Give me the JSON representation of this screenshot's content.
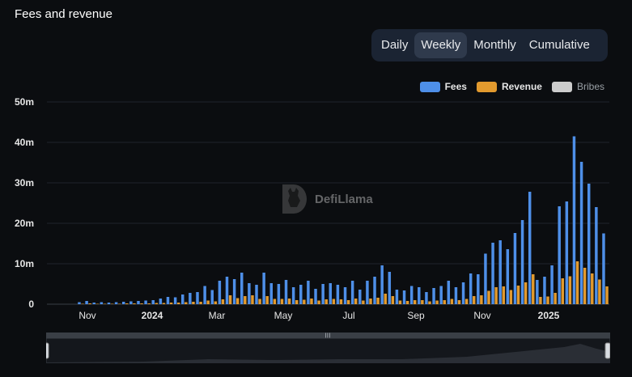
{
  "title": "Fees and revenue",
  "range_tabs": [
    "Daily",
    "Weekly",
    "Monthly",
    "Cumulative"
  ],
  "active_tab": "Weekly",
  "legend": [
    {
      "name": "Fees",
      "color": "#4e8fe8"
    },
    {
      "name": "Revenue",
      "color": "#e29a2e"
    },
    {
      "name": "Bribes",
      "color": "#cccccc"
    }
  ],
  "watermark": "DefiLlama",
  "chart_data": {
    "type": "bar",
    "ylim": [
      0,
      50000000
    ],
    "yticks": [
      "0",
      "10m",
      "20m",
      "30m",
      "40m",
      "50m"
    ],
    "x_axis_labels": [
      "Nov",
      "2024",
      "Mar",
      "May",
      "Jul",
      "Sep",
      "Nov",
      "2025"
    ],
    "series": [
      {
        "name": "Fees",
        "values": [
          0.5,
          0.8,
          0.4,
          0.5,
          0.4,
          0.5,
          0.6,
          0.7,
          0.8,
          0.9,
          1.0,
          1.4,
          1.8,
          1.7,
          2.4,
          2.8,
          3.0,
          4.5,
          3.5,
          5.8,
          6.8,
          6.2,
          7.8,
          5.2,
          4.8,
          7.8,
          5.2,
          5.0,
          6.0,
          4.2,
          4.8,
          5.8,
          3.8,
          5.0,
          5.2,
          4.8,
          4.2,
          5.8,
          3.6,
          5.8,
          6.8,
          9.6,
          8.0,
          3.6,
          3.4,
          4.5,
          4.2,
          3.0,
          4.0,
          4.5,
          5.8,
          4.2,
          5.4,
          7.6,
          7.4,
          12.5,
          15.2,
          15.8,
          13.6,
          17.6,
          20.8,
          27.8,
          6.0,
          6.8,
          9.6,
          24.2,
          25.4,
          41.5,
          35.2,
          29.8,
          24.0,
          17.5
        ],
        "color": "#4e8fe8"
      },
      {
        "name": "Revenue",
        "values": [
          0.1,
          0.2,
          0.1,
          0.1,
          0.1,
          0.1,
          0.2,
          0.2,
          0.2,
          0.2,
          0.3,
          0.3,
          0.4,
          0.4,
          0.5,
          0.6,
          0.6,
          0.9,
          0.7,
          1.2,
          2.2,
          1.5,
          2.0,
          2.2,
          1.3,
          2.0,
          1.3,
          1.3,
          1.4,
          1.0,
          1.1,
          1.4,
          0.9,
          1.2,
          1.3,
          1.2,
          1.0,
          1.4,
          0.9,
          1.4,
          1.6,
          2.6,
          2.0,
          0.9,
          0.8,
          1.0,
          1.0,
          0.7,
          0.9,
          1.0,
          1.3,
          1.0,
          1.3,
          2.0,
          2.2,
          3.3,
          4.2,
          4.4,
          3.5,
          4.6,
          5.4,
          7.4,
          1.8,
          1.9,
          2.8,
          6.4,
          6.9,
          10.6,
          9.0,
          7.6,
          6.1,
          4.4
        ],
        "color": "#e29a2e"
      }
    ],
    "value_unit": "m"
  }
}
